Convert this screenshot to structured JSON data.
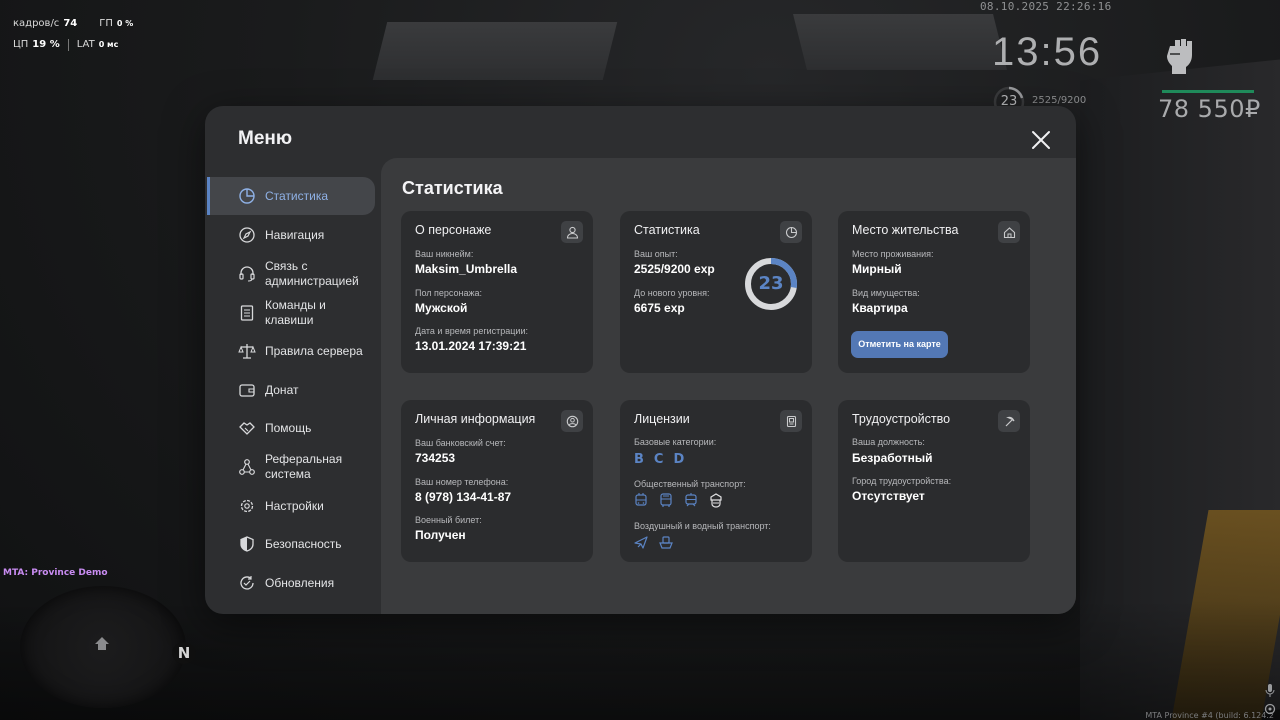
{
  "hud": {
    "fps_label": "кадров/с",
    "fps_value": "74",
    "gp_label": "ГП",
    "gp_value": "0 %",
    "cpu_label": "ЦП",
    "cpu_value": "19 %",
    "lat_label": "LAT",
    "lat_value": "0 мс",
    "datetime": "08.10.2025 22:26:16",
    "clock": "13:56",
    "level": "23",
    "exp": "2525/9200",
    "money": "78 550₽",
    "server_name": "MTA: Province Demo",
    "map_north": "N",
    "build_info": "MTA Province #4 (build: 6.124.2"
  },
  "menu": {
    "title": "Меню",
    "close_icon": "close-icon"
  },
  "sidebar": {
    "items": [
      {
        "label": "Статистика",
        "icon": "pie-chart-icon",
        "active": true
      },
      {
        "label": "Навигация",
        "icon": "compass-icon"
      },
      {
        "label": "Связь с администрацией",
        "icon": "headset-icon"
      },
      {
        "label": "Команды и клавиши",
        "icon": "document-icon"
      },
      {
        "label": "Правила сервера",
        "icon": "scales-icon"
      },
      {
        "label": "Донат",
        "icon": "wallet-icon"
      },
      {
        "label": "Помощь",
        "icon": "handshake-icon"
      },
      {
        "label": "Реферальная система",
        "icon": "network-icon"
      },
      {
        "label": "Настройки",
        "icon": "gear-icon"
      },
      {
        "label": "Безопасность",
        "icon": "shield-icon"
      },
      {
        "label": "Обновления",
        "icon": "refresh-check-icon"
      }
    ]
  },
  "content": {
    "title": "Статистика",
    "character": {
      "title": "О персонаже",
      "nickname_label": "Ваш никнейм:",
      "nickname": "Maksim_Umbrella",
      "gender_label": "Пол персонажа:",
      "gender": "Мужской",
      "reg_label": "Дата и время регистрации:",
      "reg_date": "13.01.2024 17:39:21"
    },
    "stats": {
      "title": "Статистика",
      "exp_label": "Ваш опыт:",
      "exp_value": "2525/9200 exp",
      "next_label": "До нового уровня:",
      "next_value": "6675 exp",
      "level": "23",
      "progress": 0.274,
      "accent": "#5b84c4"
    },
    "residence": {
      "title": "Место жительства",
      "place_label": "Место проживания:",
      "place": "Мирный",
      "property_label": "Вид имущества:",
      "property": "Квартира",
      "map_button": "Отметить на карте"
    },
    "personal": {
      "title": "Личная информация",
      "bank_label": "Ваш банковский счет:",
      "bank": "734253",
      "phone_label": "Ваш номер телефона:",
      "phone": "8 (978) 134-41-87",
      "military_label": "Военный билет:",
      "military": "Получен"
    },
    "licenses": {
      "title": "Лицензии",
      "basic_label": "Базовые категории:",
      "categories": [
        "B",
        "C",
        "D"
      ],
      "public_label": "Общественный транспорт:",
      "public_icons": [
        "trolleybus-icon",
        "bus-icon",
        "tram-icon",
        "taxi-badge-icon"
      ],
      "air_label": "Воздушный и водный транспорт:",
      "air_icons": [
        "plane-icon",
        "boat-icon"
      ]
    },
    "employment": {
      "title": "Трудоустройство",
      "position_label": "Ваша должность:",
      "position": "Безработный",
      "city_label": "Город трудоустройства:",
      "city": "Отсутствует"
    }
  }
}
